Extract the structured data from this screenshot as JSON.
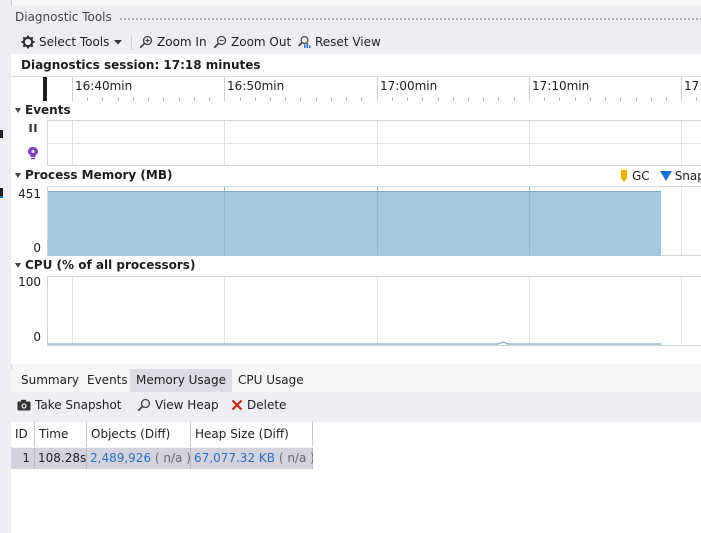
{
  "window": {
    "title": "Diagnostic Tools"
  },
  "toolbar": {
    "select_tools": "Select Tools",
    "zoom_in": "Zoom In",
    "zoom_out": "Zoom Out",
    "reset_view": "Reset View"
  },
  "session": {
    "label": "Diagnostics session: 17:18 minutes"
  },
  "ruler": {
    "ticks": [
      "16:40min",
      "16:50min",
      "17:00min",
      "17:10min",
      "17:"
    ]
  },
  "events": {
    "title": "Events"
  },
  "memory": {
    "title": "Process Memory (MB)",
    "y_max": "451",
    "y_min": "0",
    "legend": {
      "gc": "GC",
      "snapshot": "Snap"
    },
    "colors": {
      "fill": "#a6c8dc",
      "gc": "#f0b400",
      "snapshot": "#1e73c8"
    }
  },
  "cpu": {
    "title": "CPU (% of all processors)",
    "y_max": "100",
    "y_min": "0"
  },
  "tabs": [
    "Summary",
    "Events",
    "Memory Usage",
    "CPU Usage"
  ],
  "actions": {
    "take_snapshot": "Take Snapshot",
    "view_heap": "View Heap",
    "delete": "Delete"
  },
  "table": {
    "headers": [
      "ID",
      "Time",
      "Objects (Diff)",
      "Heap Size (Diff)"
    ],
    "rows": [
      {
        "id": "1",
        "time": "108.28s",
        "objects": "2,489,926",
        "objects_diff": "( n/a )",
        "heap": "67,077.32 KB",
        "heap_diff": "( n/a )"
      }
    ]
  }
}
